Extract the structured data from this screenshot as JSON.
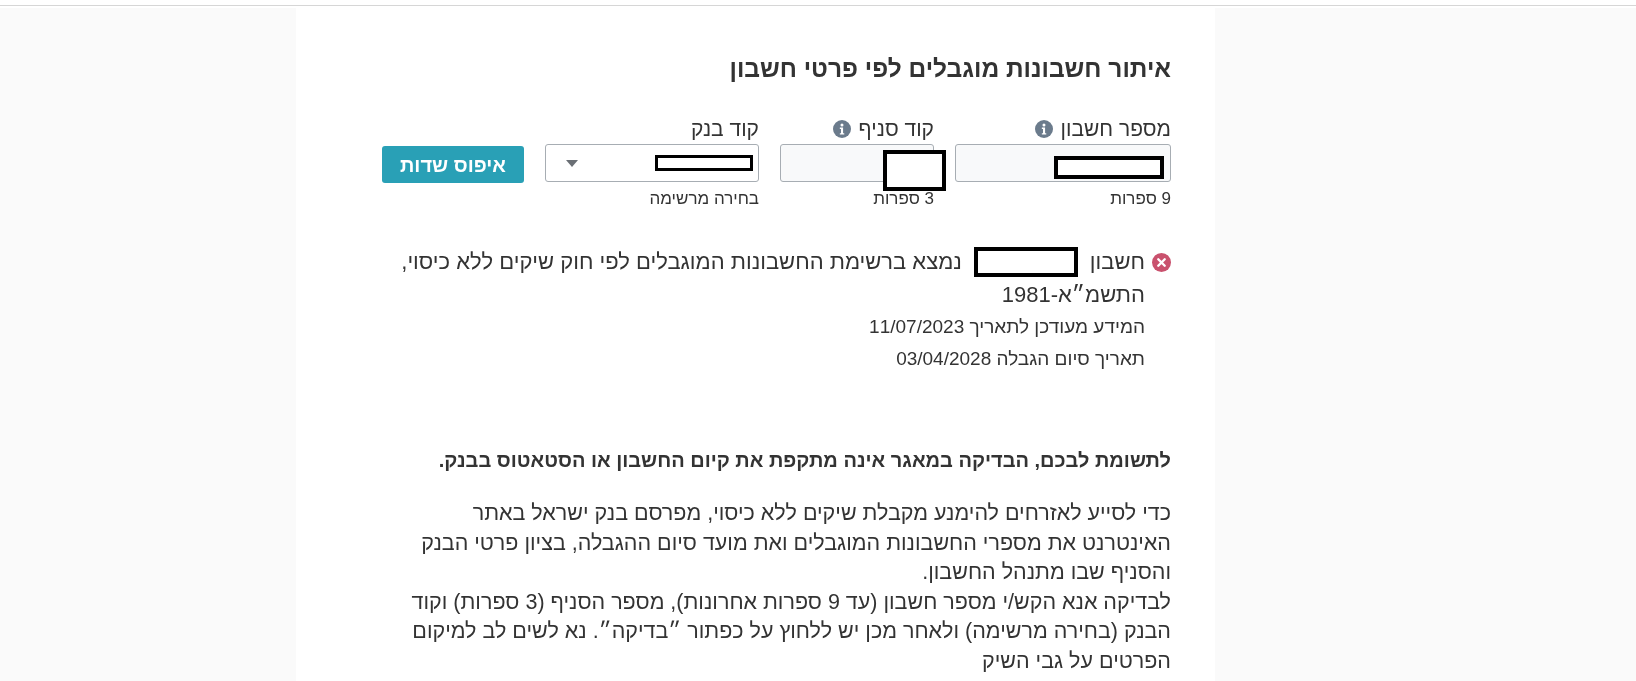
{
  "title": "איתור חשבונות מוגבלים לפי פרטי חשבון",
  "form": {
    "fields": [
      {
        "kind": "text",
        "label": "מספר חשבון",
        "info": true,
        "hint": "9 ספרות",
        "redacted": true
      },
      {
        "kind": "text",
        "label": "קוד סניף",
        "info": true,
        "hint": "3 ספרות",
        "redacted": true
      },
      {
        "kind": "select",
        "label": "קוד בנק",
        "info": false,
        "hint": "בחירה מרשימה",
        "redacted": true
      }
    ],
    "reset_button": "איפוס שדות"
  },
  "result": {
    "kind": "error",
    "account_label": "חשבון",
    "account_redacted": true,
    "message": "נמצא ברשימת החשבונות המוגבלים לפי חוק שיקים ללא כיסוי,",
    "message_end": "התשמ״א-1981",
    "updated": "המידע מעודכן לתאריך 11/07/2023",
    "restriction_end": "תאריך סיום הגבלה 03/04/2028"
  },
  "notice": "לתשומת לבכם, הבדיקה במאגר אינה מתקפת את קיום החשבון או הסטאטוס בבנק.",
  "paragraphs": [
    "כדי לסייע לאזרחים להימנע מקבלת שיקים ללא כיסוי, מפרסם בנק ישראל באתר האינטרנט את מספרי החשבונות המוגבלים ואת מועד סיום ההגבלה, בציון פרטי הבנק והסניף שבו מתנהל החשבון.",
    "לבדיקה אנא הקש/י מספר חשבון (עד 9 ספרות אחרונות), מספר הסניף (3 ספרות) וקוד הבנק (בחירה מרשימה) ולאחר מכן יש ללחוץ על כפתור ״בדיקה״. נא לשים לב למיקום הפרטים על גבי השיק"
  ]
}
